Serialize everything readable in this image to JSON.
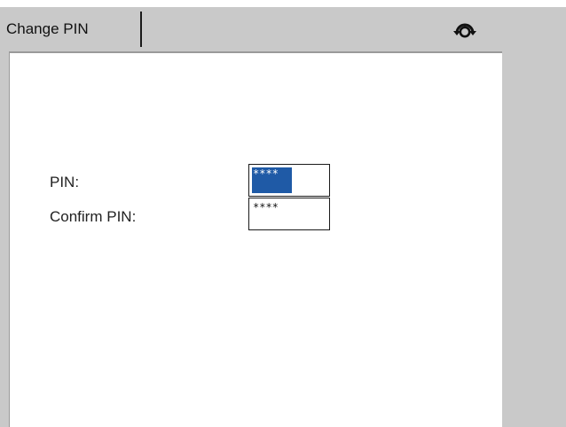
{
  "header": {
    "tab_label": "Change PIN",
    "icon": "rotate-icon"
  },
  "form": {
    "pin": {
      "label": "PIN:",
      "value": "****",
      "selected": true
    },
    "confirm_pin": {
      "label": "Confirm PIN:",
      "value": "****"
    }
  },
  "colors": {
    "chrome_gray": "#c9c9c9",
    "selection_blue": "#1f5aa6"
  }
}
